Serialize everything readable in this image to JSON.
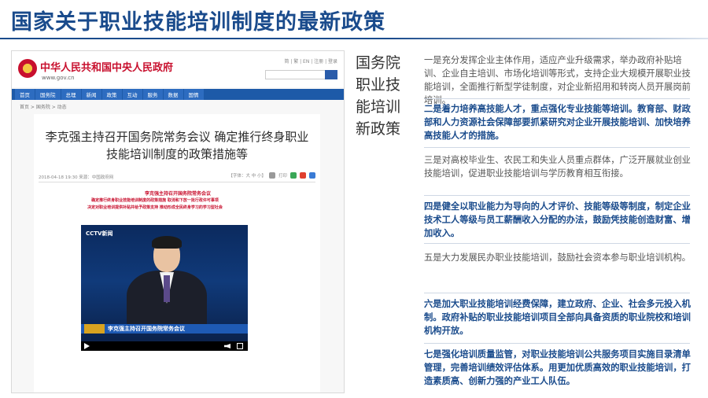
{
  "slide": {
    "title": "国家关于职业技能培训制度的最新政策"
  },
  "site": {
    "name": "中华人民共和国中央人民政府",
    "url": "www.gov.cn",
    "top_links": "简 | 繁 | EN | 注册 | 登录",
    "nav": [
      "首页",
      "国务院",
      "总理",
      "新闻",
      "政策",
      "互动",
      "服务",
      "数据",
      "国情"
    ],
    "breadcrumb": "首页 > 国务院 > 动态"
  },
  "article": {
    "title": "李克强主持召开国务院常务会议 确定推行终身职业技能培训制度的政策措施等",
    "meta": "2018-04-18 19:30   来源：中国政府网",
    "font_tool": "【字体：大 中 小】",
    "print": "打印",
    "red_head": "李克强主持召开国务院常务会议",
    "red_line1": "确定推行终身职业技能培训制度的政策措施 取消和下放一批行政许可事项",
    "red_line2": "决定对职业培训提供补贴并给予政策支持 推动形成全民终身学习的学习型社会"
  },
  "video": {
    "channel": "CCTV新闻",
    "caption": "李克强主持召开国务院常务会议"
  },
  "side_label": [
    "国务院",
    "职业技",
    "能培训",
    "新政策"
  ],
  "items": [
    {
      "text": "一是充分发挥企业主体作用，适应产业升级需求，举办政府补贴培训、企业自主培训、市场化培训等形式，支持企业大规模开展职业技能培训，全面推行新型学徒制度，对企业新招用和转岗人员开展岗前培训。",
      "highlight": false
    },
    {
      "text": "二是着力培养高技能人才，重点强化专业技能等培训。教育部、财政部和人力资源社会保障部要抓紧研究对企业开展技能培训、加快培养高技能人才的措施。",
      "highlight": true
    },
    {
      "text": "三是对高校毕业生、农民工和失业人员重点群体，广泛开展就业创业技能培训，促进职业技能培训与学历教育相互衔接。",
      "highlight": false
    },
    {
      "text": "四是健全以职业能力为导向的人才评价、技能等级等制度，制定企业技术工人等级与员工薪酬收入分配的办法，鼓励凭技能创造财富、增加收入。",
      "highlight": true
    },
    {
      "text": "五是大力发展民办职业技能培训，鼓励社会资本参与职业培训机构。",
      "highlight": false
    },
    {
      "text": "六是加大职业技能培训经费保障，建立政府、企业、社会多元投入机制。政府补贴的职业技能培训项目全部向具备资质的职业院校和培训机构开放。",
      "highlight": true
    },
    {
      "text": "七是强化培训质量监管，对职业技能培训公共服务项目实施目录清单管理，完善培训绩效评估体系。用更加优质高效的职业技能培训，打造素质高、创新力强的产业工人队伍。",
      "highlight": true
    }
  ],
  "colors": {
    "title": "#1a4b8c",
    "site_red": "#c8102e",
    "nav_blue": "#1d5aa8"
  }
}
